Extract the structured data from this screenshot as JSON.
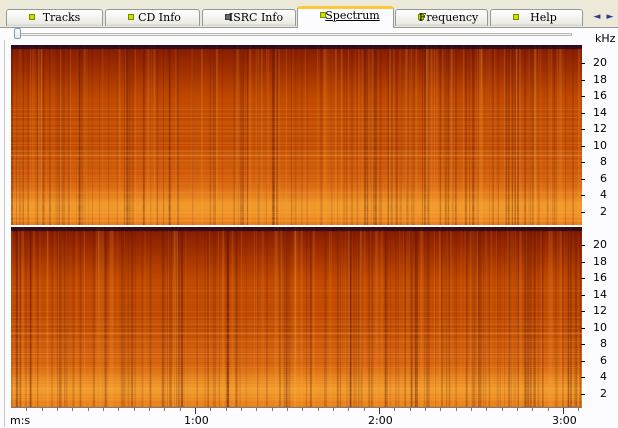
{
  "tabs": [
    {
      "label": "Tracks",
      "indicator": "green"
    },
    {
      "label": "CD Info",
      "indicator": "green"
    },
    {
      "label": "ISRC Info",
      "indicator": "gray"
    },
    {
      "label": "Spectrum",
      "indicator": "green",
      "active": true
    },
    {
      "label": "Frequency",
      "indicator": "green"
    },
    {
      "label": "Help",
      "indicator": "green"
    }
  ],
  "nav": {
    "left_arrow": "◄",
    "right_arrow": "►"
  },
  "spectrum": {
    "unit": "kHz",
    "frequency_ticks": [
      "20",
      "18",
      "16",
      "14",
      "12",
      "10",
      "8",
      "6",
      "4",
      "2"
    ],
    "channels": [
      "upper",
      "lower"
    ],
    "colors": {
      "low": "#8a1e00",
      "mid": "#c14a00",
      "high": "#f29a2a",
      "dark_band": "#2a0a1e"
    }
  },
  "timeline": {
    "start_label": "m:s",
    "marks": [
      "1:00",
      "2:00",
      "3:00"
    ]
  }
}
